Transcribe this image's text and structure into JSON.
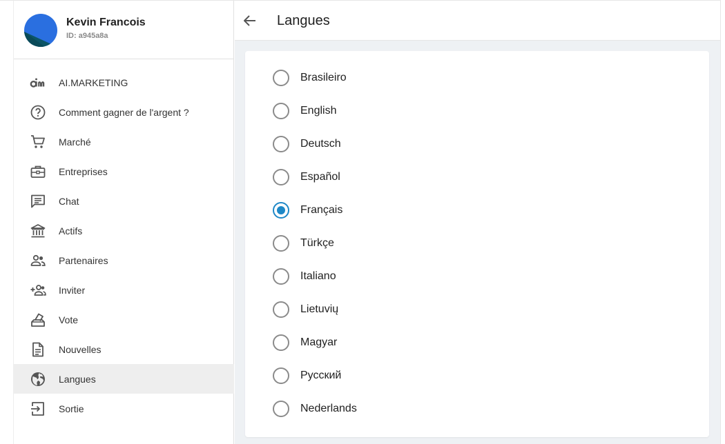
{
  "profile": {
    "name": "Kevin Francois",
    "id": "ID: a945a8a",
    "avatar_colors": [
      "#2a6fe0",
      "#0c5566"
    ]
  },
  "sidebar": {
    "items": [
      {
        "label": "AI.MARKETING",
        "icon": "aim-logo-icon",
        "active": false
      },
      {
        "label": "Comment gagner de l'argent ?",
        "icon": "help-circle-icon",
        "active": false
      },
      {
        "label": "Marché",
        "icon": "cart-icon",
        "active": false
      },
      {
        "label": "Entreprises",
        "icon": "briefcase-icon",
        "active": false
      },
      {
        "label": "Chat",
        "icon": "chat-icon",
        "active": false
      },
      {
        "label": "Actifs",
        "icon": "bank-icon",
        "active": false
      },
      {
        "label": "Partenaires",
        "icon": "people-icon",
        "active": false
      },
      {
        "label": "Inviter",
        "icon": "add-people-icon",
        "active": false
      },
      {
        "label": "Vote",
        "icon": "ballot-icon",
        "active": false
      },
      {
        "label": "Nouvelles",
        "icon": "document-icon",
        "active": false
      },
      {
        "label": "Langues",
        "icon": "globe-icon",
        "active": true
      },
      {
        "label": "Sortie",
        "icon": "logout-icon",
        "active": false
      }
    ]
  },
  "header": {
    "title": "Langues",
    "back_icon": "arrow-left-icon"
  },
  "languages": {
    "selected": "Français",
    "options": [
      {
        "label": "Brasileiro",
        "checked": false
      },
      {
        "label": "English",
        "checked": false
      },
      {
        "label": "Deutsch",
        "checked": false
      },
      {
        "label": "Español",
        "checked": false
      },
      {
        "label": "Français",
        "checked": true
      },
      {
        "label": "Türkçe",
        "checked": false
      },
      {
        "label": "Italiano",
        "checked": false
      },
      {
        "label": "Lietuvių",
        "checked": false
      },
      {
        "label": "Magyar",
        "checked": false
      },
      {
        "label": "Русский",
        "checked": false
      },
      {
        "label": "Nederlands",
        "checked": false
      }
    ]
  },
  "colors": {
    "accent": "#1e88c7",
    "active_bg": "#eeeeee",
    "content_bg": "#eef1f4",
    "icon": "#555555"
  }
}
